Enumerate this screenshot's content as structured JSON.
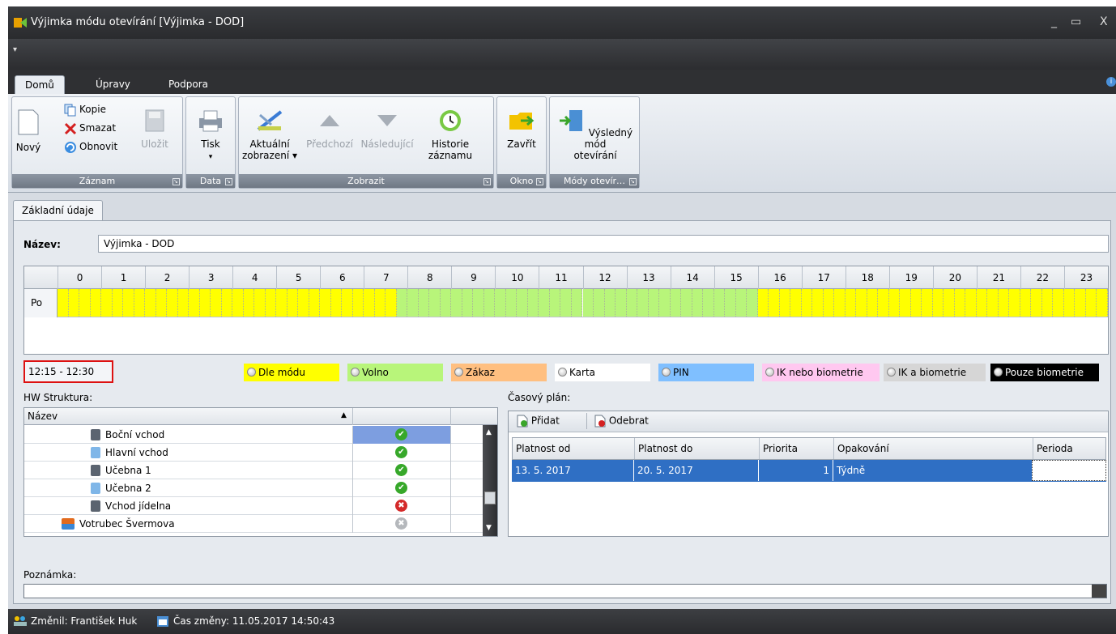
{
  "window": {
    "title": "Výjimka módu otevírání [Výjimka - DOD]",
    "minimize": "_",
    "maximize": "▭",
    "close": "X"
  },
  "ribbon_tabs": [
    "Domů",
    "Úpravy",
    "Podpora"
  ],
  "ribbon": {
    "zaznam": {
      "label": "Záznam",
      "novy": "Nový",
      "kopie": "Kopie",
      "smazat": "Smazat",
      "obnovit": "Obnovit",
      "ulozit": "Uložit"
    },
    "data": {
      "label": "Data",
      "tisk": "Tisk"
    },
    "zobrazit": {
      "label": "Zobrazit",
      "aktualni": "Aktuální",
      "zobrazeni": "zobrazení",
      "predchozi": "Předchozí",
      "nasledujici": "Následující",
      "historie": "Historie",
      "zaznamu": "záznamu"
    },
    "okno": {
      "label": "Okno",
      "zavrit": "Zavřít"
    },
    "mody": {
      "label": "Módy otevír…",
      "vysledny": "Výsledný mód",
      "oteviranI": "otevírání"
    }
  },
  "panel_tab": "Základní údaje",
  "nazev": {
    "label": "Název:",
    "value": "Výjimka - DOD"
  },
  "schedule": {
    "hours": [
      "0",
      "1",
      "2",
      "3",
      "4",
      "5",
      "6",
      "7",
      "8",
      "9",
      "10",
      "11",
      "12",
      "13",
      "14",
      "15",
      "16",
      "17",
      "18",
      "19",
      "20",
      "21",
      "22",
      "23"
    ],
    "day": "Po",
    "segments": [
      {
        "from_hour": 0,
        "to_hour": 7.75,
        "mode": "Dle módu"
      },
      {
        "from_hour": 7.75,
        "to_hour": 16,
        "mode": "Volno"
      },
      {
        "from_hour": 16,
        "to_hour": 24,
        "mode": "Dle módu"
      }
    ]
  },
  "selected_range": "12:15 - 12:30",
  "legend": [
    {
      "label": "Dle módu",
      "color": "#ffff00"
    },
    {
      "label": "Volno",
      "color": "#b8f57a"
    },
    {
      "label": "Zákaz",
      "color": "#ffbf80"
    },
    {
      "label": "Karta",
      "color": "#ffffff"
    },
    {
      "label": "PIN",
      "color": "#7fbfff"
    },
    {
      "label": "IK nebo biometrie",
      "color": "#ffc8f0"
    },
    {
      "label": "IK a biometrie",
      "color": "#d6d6d6"
    },
    {
      "label": "Pouze biometrie",
      "color": "#000000"
    }
  ],
  "colors": {
    "dle_modu": "#ffff00",
    "volno": "#b8f57a"
  },
  "hw": {
    "label": "HW Struktura:",
    "column": "Název",
    "sort_icon": "▲",
    "rows": [
      {
        "name": "Boční vchod",
        "status": "ok",
        "selected": true
      },
      {
        "name": "Hlavní vchod",
        "status": "ok",
        "selected": false
      },
      {
        "name": "Učebna 1",
        "status": "ok",
        "selected": false
      },
      {
        "name": "Učebna 2",
        "status": "ok",
        "selected": false
      },
      {
        "name": "Vchod jídelna",
        "status": "error",
        "selected": false
      },
      {
        "name": "Votrubec Švermova",
        "status": "disabled",
        "selected": false
      }
    ]
  },
  "plan": {
    "label": "Časový plán:",
    "add": "Přidat",
    "remove": "Odebrat",
    "columns": [
      "Platnost od",
      "Platnost do",
      "Priorita",
      "Opakování",
      "Perioda"
    ],
    "rows": [
      [
        "13. 5. 2017",
        "20. 5. 2017",
        "1",
        "Týdně",
        ""
      ]
    ]
  },
  "poznamka": {
    "label": "Poznámka:"
  },
  "status": {
    "changed_by": "Změnil: František Huk",
    "changed_at": "Čas změny: 11.05.2017 14:50:43"
  }
}
